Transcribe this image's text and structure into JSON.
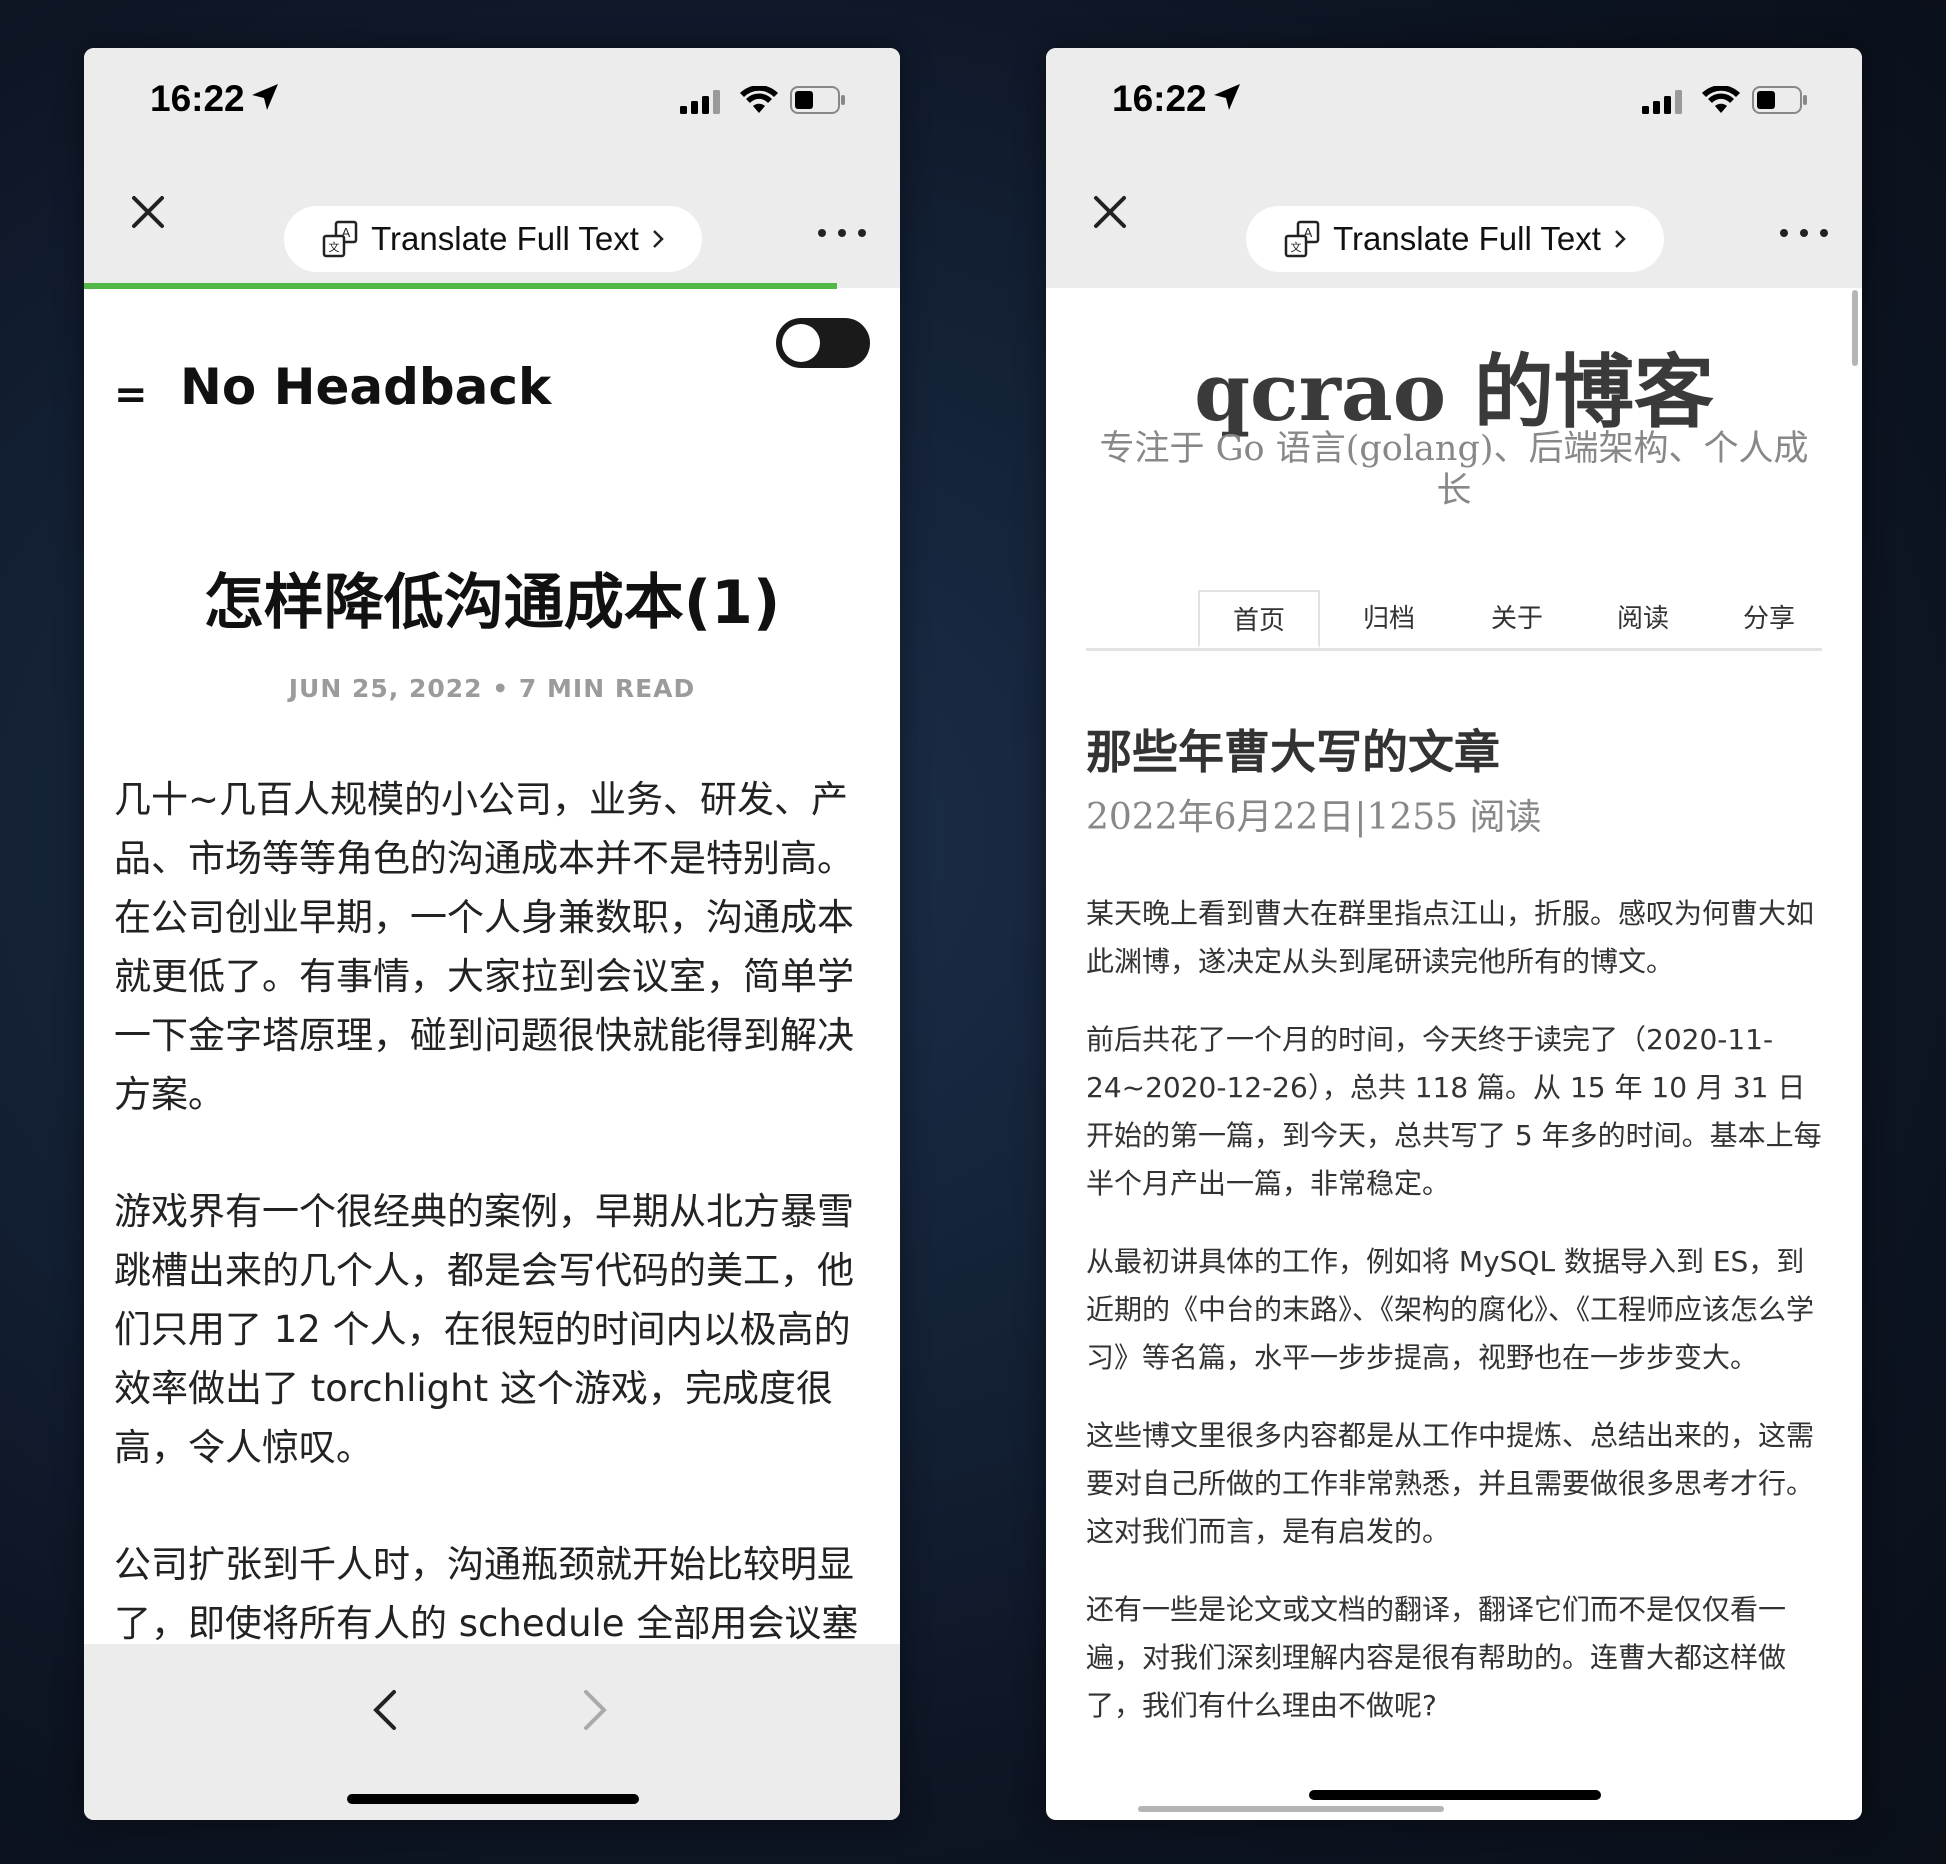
{
  "left": {
    "status_time": "16:22",
    "translate_label": "Translate Full Text",
    "site_name": "No Headback",
    "hamburger": "=",
    "post_title": "怎样降低沟通成本(1)",
    "post_meta": "JUN 25, 2022  •  7 MIN READ",
    "paragraphs": [
      "几十~几百人规模的小公司，业务、研发、产品、市场等等角色的沟通成本并不是特别高。在公司创业早期，一个人身兼数职，沟通成本就更低了。有事情，大家拉到会议室，简单学一下金字塔原理，碰到问题很快就能得到解决方案。",
      "游戏界有一个很经典的案例，早期从北方暴雪跳槽出来的几个人，都是会写代码的美工，他们只用了 12 个人，在很短的时间内以极高的效率做出了 torchlight 这个游戏，完成度很高，令人惊叹。",
      "公司扩张到千人时，沟通瓶颈就开始比较明显了，即使将所有人的 schedule 全部用会议塞满，还是难以快速有效地得到结论，所有人看"
    ]
  },
  "right": {
    "status_time": "16:22",
    "translate_label": "Translate Full Text",
    "blog_title": "qcrao 的博客",
    "blog_subtitle": "专注于 Go 语言(golang)、后端架构、个人成长",
    "tabs": [
      "首页",
      "归档",
      "关于",
      "阅读",
      "分享"
    ],
    "article_title": "那些年曹大写的文章",
    "article_meta": "2022年6月22日|1255 阅读",
    "paragraphs": [
      "某天晚上看到曹大在群里指点江山，折服。感叹为何曹大如此渊博，遂决定从头到尾研读完他所有的博文。",
      "前后共花了一个月的时间，今天终于读完了（2020-11-24~2020-12-26），总共 118 篇。从 15 年 10 月 31 日开始的第一篇，到今天，总共写了 5 年多的时间。基本上每半个月产出一篇，非常稳定。",
      "从最初讲具体的工作，例如将 MySQL 数据导入到 ES，到近期的《中台的末路》、《架构的腐化》、《工程师应该怎么学习》等名篇，水平一步步提高，视野也在一步步变大。",
      "这些博文里很多内容都是从工作中提炼、总结出来的，这需要对自己所做的工作非常熟悉，并且需要做很多思考才行。这对我们而言，是有启发的。",
      "还有一些是论文或文档的翻译，翻译它们而不是仅仅看一遍，对我们深刻理解内容是很有帮助的。连曹大都这样做了，我们有什么理由不做呢?"
    ]
  },
  "colors": {
    "progress_green": "#53b848",
    "chrome_gray": "#ececec",
    "meta_gray": "#9b9b9b"
  },
  "icons": [
    "location-arrow-icon",
    "signal-icon",
    "wifi-icon",
    "battery-icon",
    "close-icon",
    "translate-icon",
    "chevron-right-icon",
    "more-icon",
    "hamburger-icon",
    "toggle-switch",
    "back-arrow-icon",
    "forward-arrow-icon"
  ]
}
